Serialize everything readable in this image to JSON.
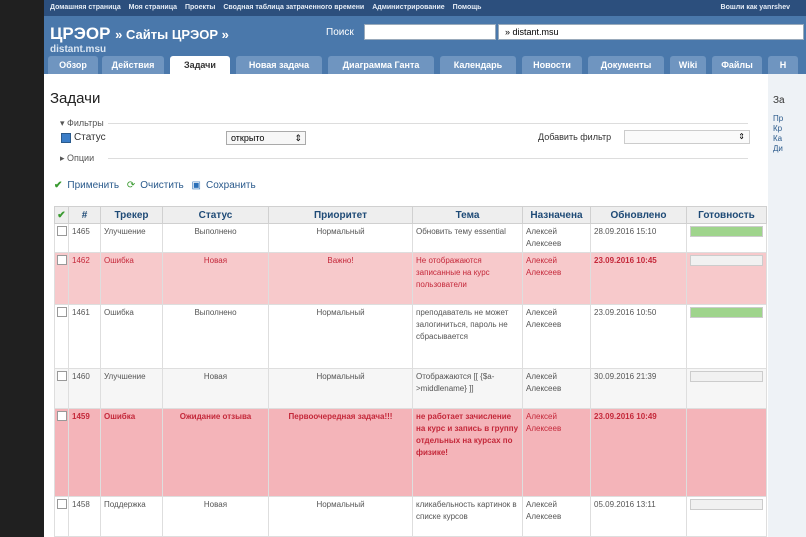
{
  "topbar": {
    "links": [
      "Домашняя страница",
      "Моя страница",
      "Проекты",
      "Сводная таблица затраченного времени",
      "Администрирование",
      "Помощь"
    ],
    "login": "Вошли как yanrshev"
  },
  "header": {
    "title": "ЦРЭОР",
    "breadcrumb": "» Сайты ЦРЭОР »",
    "subtitle": "distant.msu",
    "search_label": "Поиск",
    "search_value": "",
    "project_select": "» distant.msu"
  },
  "tabs": [
    "Обзор",
    "Действия",
    "Задачи",
    "Новая задача",
    "Диаграмма Ганта",
    "Календарь",
    "Новости",
    "Документы",
    "Wiki",
    "Файлы",
    "Н"
  ],
  "active_tab": "Задачи",
  "page": {
    "heading": "Задачи",
    "filters_legend": "▾ Фильтры",
    "filter_label": "Статус",
    "filter_op": "открыто",
    "add_filter_label": "Добавить фильтр",
    "options_legend": "▸ Опции",
    "apply": "Применить",
    "clear": "Очистить",
    "save": "Сохранить"
  },
  "sidebar": {
    "title": "За",
    "items": [
      "Пр",
      "Кр",
      "Ка",
      "Ди"
    ]
  },
  "table": {
    "columns": [
      "#",
      "Трекер",
      "Статус",
      "Приоритет",
      "Тема",
      "Назначена",
      "Обновлено",
      "Готовность"
    ],
    "rows": [
      {
        "id": "1465",
        "tracker": "Улучшение",
        "status": "Выполнено",
        "priority": "Нормальный",
        "subject": "Обновить тему essential",
        "assignee": "Алексей Алексеев",
        "updated": "28.09.2016 15:10",
        "progress": 100
      },
      {
        "id": "1462",
        "tracker": "Ошибка",
        "status": "Новая",
        "priority": "Важно!",
        "subject": "Не отображаются записанные на курс пользователи",
        "assignee": "Алексей Алексеев",
        "updated": "23.09.2016 10:45",
        "progress": 0
      },
      {
        "id": "1461",
        "tracker": "Ошибка",
        "status": "Выполнено",
        "priority": "Нормальный",
        "subject": "преподаватель не может залогиниться, пароль не сбрасывается",
        "assignee": "Алексей Алексеев",
        "updated": "23.09.2016 10:50",
        "progress": 100
      },
      {
        "id": "1460",
        "tracker": "Улучшение",
        "status": "Новая",
        "priority": "Нормальный",
        "subject": "Отображаются [[ {$a->middlename} ]]",
        "assignee": "Алексей Алексеев",
        "updated": "30.09.2016 21:39",
        "progress": 0
      },
      {
        "id": "1459",
        "tracker": "Ошибка",
        "status": "Ожидание отзыва",
        "priority": "Первоочередная задача!!!",
        "subject": "не работает зачисление на курс и запись в группу отдельных на курсах по физике!",
        "assignee": "Алексей Алексеев",
        "updated": "23.09.2016 10:49",
        "progress": 0
      },
      {
        "id": "1458",
        "tracker": "Поддержка",
        "status": "Новая",
        "priority": "Нормальный",
        "subject": "кликабельность картинок в списке курсов",
        "assignee": "Алексей Алексеев",
        "updated": "05.09.2016 13:11",
        "progress": 0
      }
    ]
  },
  "colors": {
    "header": "#4a78ab",
    "topbar": "#2c4f7d",
    "error_row": "#f7c9cb",
    "error_text": "#c4283a",
    "progress_fill": "#9fd48c"
  }
}
